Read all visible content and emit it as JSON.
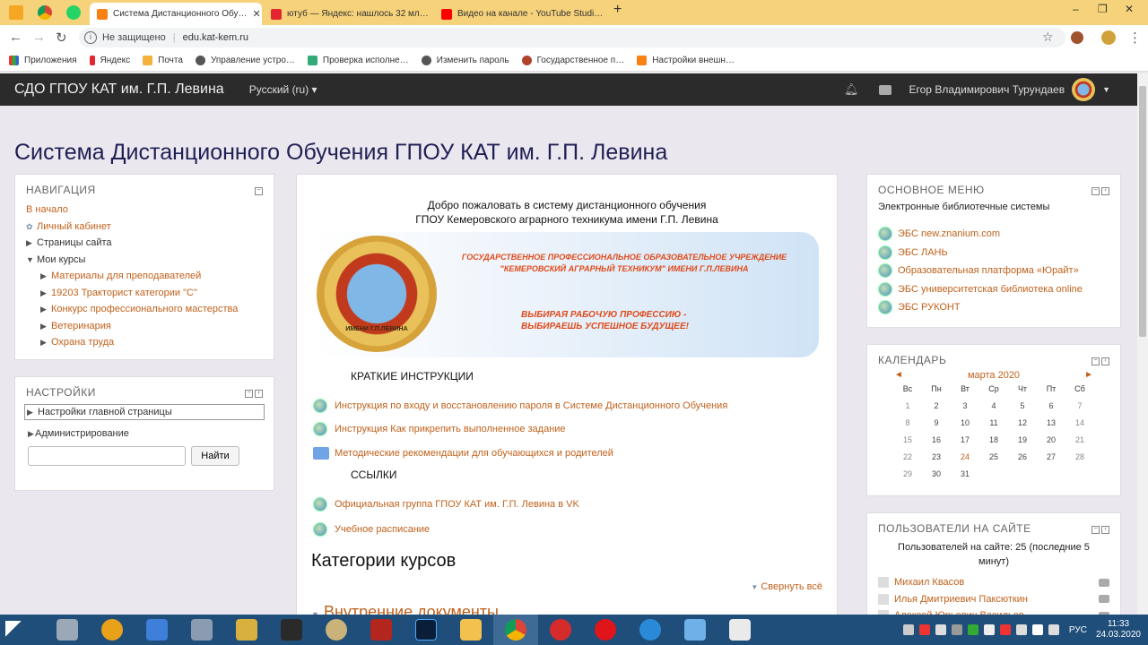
{
  "browser": {
    "tabs": [
      {
        "title": "Система Дистанционного Обу…",
        "active": true
      },
      {
        "title": "ютуб — Яндекс: нашлось 32 мл…",
        "active": false
      },
      {
        "title": "Видео на канале - YouTube Studi…",
        "active": false
      }
    ],
    "new_tab": "+",
    "window_controls": [
      "–",
      "❐",
      "✕"
    ],
    "address": {
      "security": "Не защищено",
      "url": "edu.kat-kem.ru"
    },
    "bookmarks": [
      "Приложения",
      "Яндекс",
      "Почта",
      "Управление устро…",
      "Проверка исполне…",
      "Изменить пароль",
      "Государственное п…",
      "Настройки внешн…"
    ]
  },
  "navbar": {
    "brand": "СДО ГПОУ КАТ им. Г.П. Левина",
    "language": "Русский (ru) ▾",
    "user": "Егор Владимирович Турундаев"
  },
  "page": {
    "heading": "Система Дистанционного Обучения ГПОУ КАТ им. Г.П. Левина"
  },
  "navigation": {
    "title": "НАВИГАЦИЯ",
    "home": "В начало",
    "dashboard": "Личный кабинет",
    "site_pages": "Страницы сайта",
    "my_courses": "Мои курсы",
    "courses": [
      "Материалы для преподавателей",
      "19203 Тракторист категории \"С\"",
      "Конкурс профессионального мастерства",
      "Ветеринария",
      "Охрана труда"
    ]
  },
  "settings": {
    "title": "НАСТРОЙКИ",
    "items": [
      "Настройки главной страницы",
      "Администрирование"
    ],
    "search_value": "",
    "search_button": "Найти"
  },
  "main": {
    "welcome_line1": "Добро пожаловать в систему дистанционного обучения",
    "welcome_line2": "ГПОУ Кемеровского аграрного техникума имени Г.П. Левина",
    "banner_org_line1": "ГОСУДАРСТВЕННОЕ ПРОФЕССИОНАЛЬНОЕ ОБРАЗОВАТЕЛЬНОЕ УЧРЕЖДЕНИЕ",
    "banner_org_line2": "\"КЕМЕРОВСКИЙ АГРАРНЫЙ ТЕХНИКУМ\" ИМЕНИ Г.П.ЛЕВИНА",
    "banner_slogan_line1": "ВЫБИРАЯ РАБОЧУЮ ПРОФЕССИЮ -",
    "banner_slogan_line2": "ВЫБИРАЕШЬ УСПЕШНОЕ БУДУЩЕЕ!",
    "emblem_text": "ИМЕНИ Г.П.ЛЕВИНА",
    "instructions_title": "КРАТКИЕ ИНСТРУКЦИИ",
    "instructions": [
      "Инструкция по входу и восстановлению пароля в Системе Дистанционного Обучения",
      "Инструкция Как прикрепить выполненное задание",
      "Методические рекомендации для обучающихся и родителей"
    ],
    "links_title": "ССЫЛКИ",
    "links": [
      "Официальная группа ГПОУ КАТ им. Г.П. Левина в VK",
      "Учебное расписание"
    ],
    "categories_title": "Категории курсов",
    "collapse_all": "Свернуть всё",
    "first_category": "Внутренние документы"
  },
  "main_menu": {
    "title": "ОСНОВНОЕ МЕНЮ",
    "subtitle": "Электронные библиотечные системы",
    "items": [
      "ЭБС new.znanium.com",
      "ЭБС ЛАНЬ",
      "Образовательная платформа «Юрайт»",
      "ЭБС университетская библиотека online",
      "ЭБС РУКОНТ"
    ]
  },
  "calendar": {
    "title": "КАЛЕНДАРЬ",
    "month": "марта 2020",
    "prev": "◄",
    "next": "►",
    "weekdays": [
      "Вс",
      "Пн",
      "Вт",
      "Ср",
      "Чт",
      "Пт",
      "Сб"
    ],
    "weeks": [
      [
        "1",
        "2",
        "3",
        "4",
        "5",
        "6",
        "7"
      ],
      [
        "8",
        "9",
        "10",
        "11",
        "12",
        "13",
        "14"
      ],
      [
        "15",
        "16",
        "17",
        "18",
        "19",
        "20",
        "21"
      ],
      [
        "22",
        "23",
        "24",
        "25",
        "26",
        "27",
        "28"
      ],
      [
        "29",
        "30",
        "31",
        "",
        "",
        "",
        ""
      ]
    ],
    "today": "24"
  },
  "online_users": {
    "title": "ПОЛЬЗОВАТЕЛИ НА САЙТЕ",
    "summary": "Пользователей на сайте: 25 (последние 5 минут)",
    "users": [
      "Михаил Квасов",
      "Илья Дмитриевич Паксюткин",
      "Алексей Юрьевич Васильев"
    ]
  },
  "taskbar": {
    "time": "11:33",
    "date": "24.03.2020",
    "lang": "РУС"
  },
  "colors": {
    "link": "#c0611b",
    "navbar": "#2b2b2b",
    "tabbar": "#f6d27a",
    "taskbar": "#1f4e7a"
  }
}
